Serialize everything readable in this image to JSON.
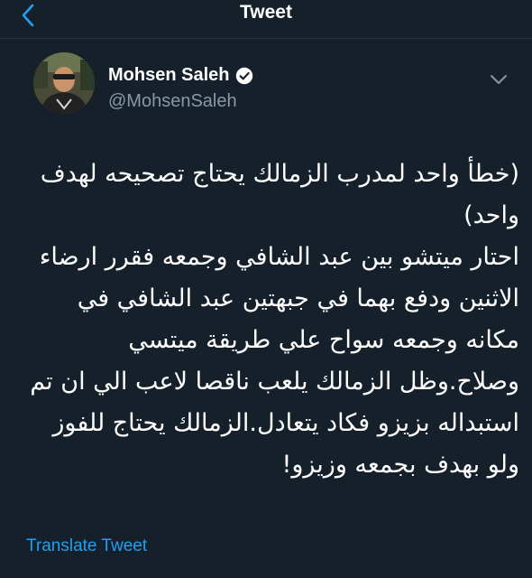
{
  "header": {
    "title": "Tweet",
    "back_icon": "chevron-left-icon"
  },
  "author": {
    "name": "Mohsen Saleh",
    "handle": "@MohsenSaleh",
    "verified_icon": "verified-badge-icon",
    "menu_icon": "chevron-down-icon"
  },
  "tweet": {
    "lines": [
      "(خطأ واحد لمدرب الزمالك يحتاج تصحيحه لهدف",
      "واحد)",
      "احتار ميتشو بين عبد الشافي وجمعه فقرر ارضاء",
      "الاثنين ودفع بهما في جبهتين عبد الشافي في",
      "مكانه وجمعه سواح علي طريقة ميتسي",
      "وصلاح.وظل الزمالك يلعب ناقصا لاعب الي ان تم",
      "استبداله بزيزو فكاد يتعادل.الزمالك يحتاج للفوز",
      "ولو بهدف بجمعه وزيزو!"
    ]
  },
  "actions": {
    "translate_label": "Translate Tweet"
  },
  "colors": {
    "background": "#15202b",
    "accent": "#1da1f2",
    "secondary_text": "#8899a6",
    "divider": "#2a3440"
  }
}
